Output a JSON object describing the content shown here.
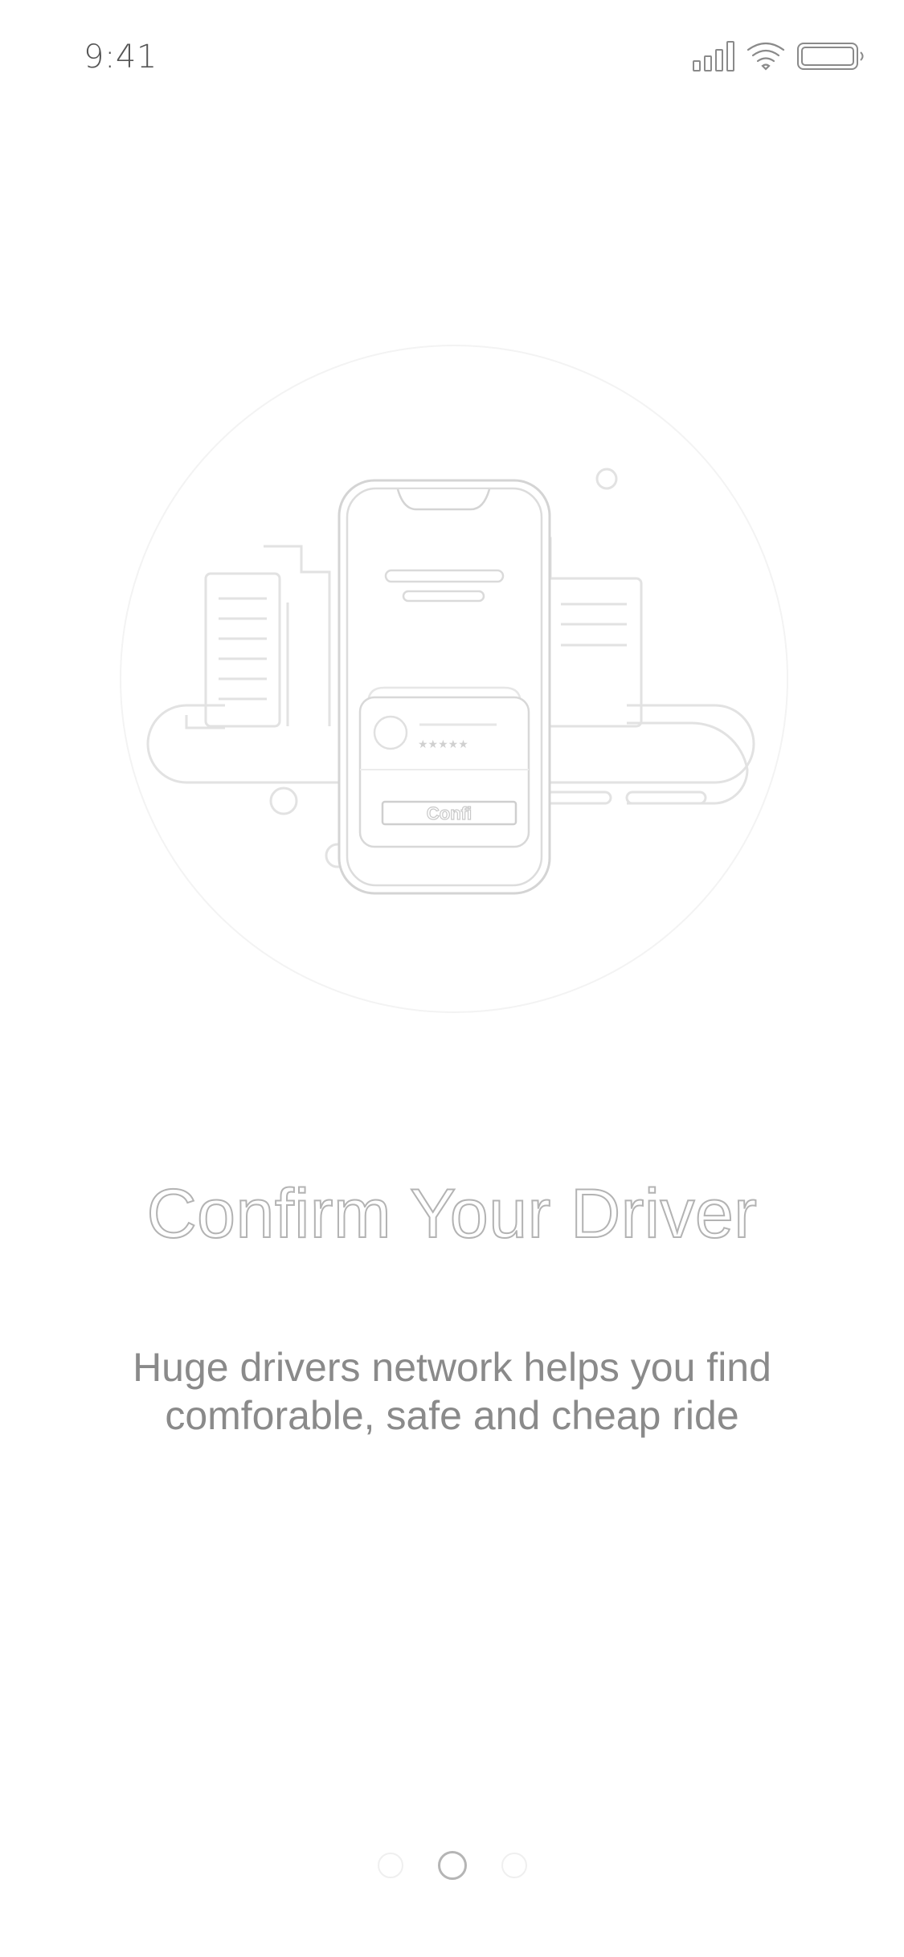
{
  "status_bar": {
    "time": "9:41",
    "icons": [
      "cellular-signal-icon",
      "wifi-icon",
      "battery-icon"
    ]
  },
  "illustration": {
    "icon": "phone-city-illustration",
    "button_label": "Confi",
    "rating": "★★★★★"
  },
  "onboarding": {
    "title": "Confirm Your Driver",
    "subtitle_line1": "Huge drivers network helps you find",
    "subtitle_line2": "comforable, safe and cheap ride"
  },
  "pager": {
    "total": 3,
    "active_index": 1
  },
  "colors": {
    "background": "#ffffff",
    "title_outline": "#b3b3b3",
    "subtitle": "#8a8a8a",
    "line_art": "#dcdcdc"
  }
}
